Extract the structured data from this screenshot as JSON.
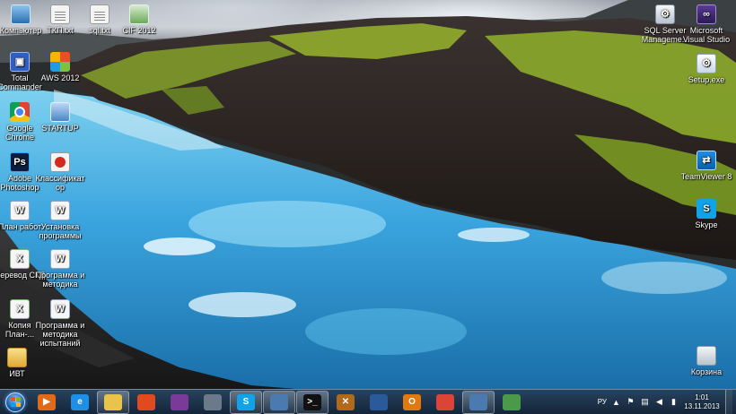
{
  "desktop": {
    "icons": [
      {
        "id": "computer",
        "label": "Компьютер",
        "glyph": ""
      },
      {
        "id": "tkp",
        "label": "ТКП.txt",
        "glyph": ""
      },
      {
        "id": "sqltxt",
        "label": "sql.txt",
        "glyph": ""
      },
      {
        "id": "cif2012",
        "label": "CIF 2012",
        "glyph": ""
      },
      {
        "id": "total-commander",
        "label": "Total Commander",
        "glyph": "▣"
      },
      {
        "id": "aws2012",
        "label": "AWS 2012",
        "glyph": ""
      },
      {
        "id": "chrome",
        "label": "Google Chrome",
        "glyph": ""
      },
      {
        "id": "startup",
        "label": "STARTUP",
        "glyph": ""
      },
      {
        "id": "photoshop",
        "label": "Adobe Photoshop",
        "glyph": "Ps"
      },
      {
        "id": "klassifikator",
        "label": "Классификатор",
        "glyph": ""
      },
      {
        "id": "plan-doc",
        "label": "План работ",
        "glyph": "W"
      },
      {
        "id": "ustanovka-doc",
        "label": "Установка программы",
        "glyph": "W"
      },
      {
        "id": "perevod-doc",
        "label": "Перевод СКД",
        "glyph": "X"
      },
      {
        "id": "programma-doc",
        "label": "Программа и методика",
        "glyph": "W"
      },
      {
        "id": "kopiya-doc",
        "label": "Копия План-...",
        "glyph": "X"
      },
      {
        "id": "programma2-doc",
        "label": "Программа и методика испытаний",
        "glyph": "W"
      },
      {
        "id": "folder-ivt",
        "label": "ИВТ",
        "glyph": ""
      },
      {
        "id": "sql-server",
        "label": "SQL Server Manageme...",
        "glyph": "⚙"
      },
      {
        "id": "microsoft-visual",
        "label": "Microsoft Visual Studio",
        "glyph": "∞"
      },
      {
        "id": "setup",
        "label": "Setup.exe",
        "glyph": "⚙"
      },
      {
        "id": "teamviewer",
        "label": "TeamViewer 8",
        "glyph": "⇄"
      },
      {
        "id": "skype",
        "label": "Skype",
        "glyph": "S"
      },
      {
        "id": "recycle-bin",
        "label": "Корзина",
        "glyph": ""
      }
    ]
  },
  "taskbar": {
    "pinned": [
      {
        "id": "media-player",
        "glyph": "▶",
        "color": "#e06a1a",
        "running": false
      },
      {
        "id": "ie",
        "glyph": "e",
        "color": "#1d8fe8",
        "running": false
      },
      {
        "id": "explorer",
        "glyph": "",
        "color": "#e9c34a",
        "running": true
      },
      {
        "id": "office",
        "glyph": "",
        "color": "#e04a1e",
        "running": false
      },
      {
        "id": "winrar",
        "glyph": "",
        "color": "#7a3a9a",
        "running": false
      },
      {
        "id": "disk",
        "glyph": "",
        "color": "#6a7a8a",
        "running": false
      },
      {
        "id": "skype",
        "glyph": "S",
        "color": "#10a3e8",
        "running": true
      },
      {
        "id": "remote-desktop",
        "glyph": "",
        "color": "#4a7ab0",
        "running": true
      },
      {
        "id": "cmd",
        "glyph": ">_",
        "color": "#111111",
        "running": true
      },
      {
        "id": "tools",
        "glyph": "✕",
        "color": "#b06a1a",
        "running": false
      },
      {
        "id": "phone",
        "glyph": "",
        "color": "#2a5a9a",
        "running": false
      },
      {
        "id": "outlook",
        "glyph": "O",
        "color": "#e07a10",
        "running": false
      },
      {
        "id": "chrome",
        "glyph": "",
        "color": "#db4437",
        "running": false
      },
      {
        "id": "network",
        "glyph": "",
        "color": "#4a7ab0",
        "running": true
      },
      {
        "id": "setup",
        "glyph": "",
        "color": "#4a9a4a",
        "running": false
      }
    ],
    "tray": {
      "language": "РУ",
      "time": "1:01",
      "date": "13.11.2013"
    }
  }
}
